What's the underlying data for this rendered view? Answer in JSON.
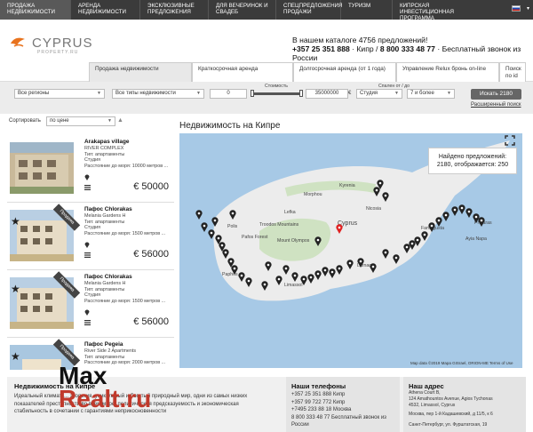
{
  "topnav": {
    "items": [
      "Продажа недвижимости",
      "Аренда недвижимости",
      "Эксклюзивные предложения",
      "Для вечеринок и свадеб",
      "Спецпредложения продажи",
      "Туризм",
      "Кипрская Инвестиционная Программа"
    ]
  },
  "logo": {
    "name": "CYPRUS",
    "sub": "PROPERTY.RU"
  },
  "header": {
    "catalog": "В нашем каталоге 4756 предложений!",
    "phones_a": "+357 25 351 888",
    "phones_b": " · Кипр / ",
    "phones_c": "8 800 333 48 77",
    "phones_d": " · Бесплатный звонок из России"
  },
  "tabs": [
    "Продажа недвижимости",
    "Краткосрочная аренда",
    "Долгосрочная аренда (от 1 года)",
    "Управление Relux бронь on-line",
    "Поиск по id"
  ],
  "filters": {
    "region": "Все регионы",
    "type": "Все типы недвижимости",
    "price_label": "Стоимость",
    "price_min": "0",
    "price_max": "35000000",
    "currency": "€",
    "rooms_label": "Спален от / до",
    "rooms_type": "Студия",
    "rooms_to": "7 и более",
    "search_button": "Искать 2180",
    "advanced": "Расширенный поиск"
  },
  "sort": {
    "label": "Сортировать",
    "value": "по цене"
  },
  "map": {
    "title": "Недвижимость на Кипре",
    "found_line1": "Найдено предложений:",
    "found_line2": "2180, отображается: 250",
    "attribution": "Map data ©2019 Mapa GISrael, ORION-ME   Terms of Use",
    "places": [
      "Cyprus",
      "Paphos",
      "Limassol",
      "Larnaca",
      "Nicosia",
      "Kyrenia",
      "Famagusta",
      "Troodos Mountains",
      "Mount Olympos",
      "Polis",
      "Pafos Forest",
      "Lefka",
      "Morphou",
      "Ayia Napa",
      "Protaras"
    ]
  },
  "listings": [
    {
      "title": "Arakapas village",
      "line1": "RIVER COMPLEX",
      "line2": "Тип: апартаменты",
      "line3": "Студия",
      "line4": "Расстояние до моря: 10000 метров ...",
      "price": "€ 50000",
      "ribbon": ""
    },
    {
      "title": "Пафос Chlorakas",
      "line1": "Melania Gardens H",
      "line2": "Тип: апартаменты",
      "line3": "Студия",
      "line4": "Расстояние до моря: 1500 метров ...",
      "price": "€ 56000",
      "ribbon": "Продажа"
    },
    {
      "title": "Пафос Chlorakas",
      "line1": "Melania Gardens H",
      "line2": "Тип: апартаменты",
      "line3": "Студия",
      "line4": "Расстояние до моря: 1500 метров ...",
      "price": "€ 56000",
      "ribbon": "Продажа"
    },
    {
      "title": "Пафос Pegeia",
      "line1": "River Side 2 Apartments",
      "line2": "Тип: апартаменты",
      "line3": "Студия",
      "line4": "Расстояние до моря: 2000 метров ...",
      "price": "",
      "ribbon": "Продажа"
    }
  ],
  "footer": {
    "about_title": "Недвижимость на Кипре",
    "about_text": "Идеальный климат, ... экология, уникальный и богатый природный мир, одни из самых низких показателей преступности во всем мире, политическая предсказуемость и экономическая стабильность в сочетании с гарантиями неприкосновенности",
    "phones_title": "Наши телефоны",
    "phones": [
      "+357 25 351 888 Кипр",
      "+357 99 722 772 Кипр",
      "+7495 233 88 18 Москва",
      "8 800 333 48 77 Бесплатный звонок из России"
    ],
    "address_title": "Наш адрес",
    "address": [
      "Athena Court B,",
      "124 Amathountos Avenue, Agios Tychonas",
      "4532, Limassol, Cyprus",
      "Москва, пер 1-й Кадашевский, д 11/5, к 6",
      "Санкт-Петербург, ул. Фурштатская, 19"
    ]
  },
  "watermark": {
    "a": "Max",
    "b": "Realt.ru"
  }
}
